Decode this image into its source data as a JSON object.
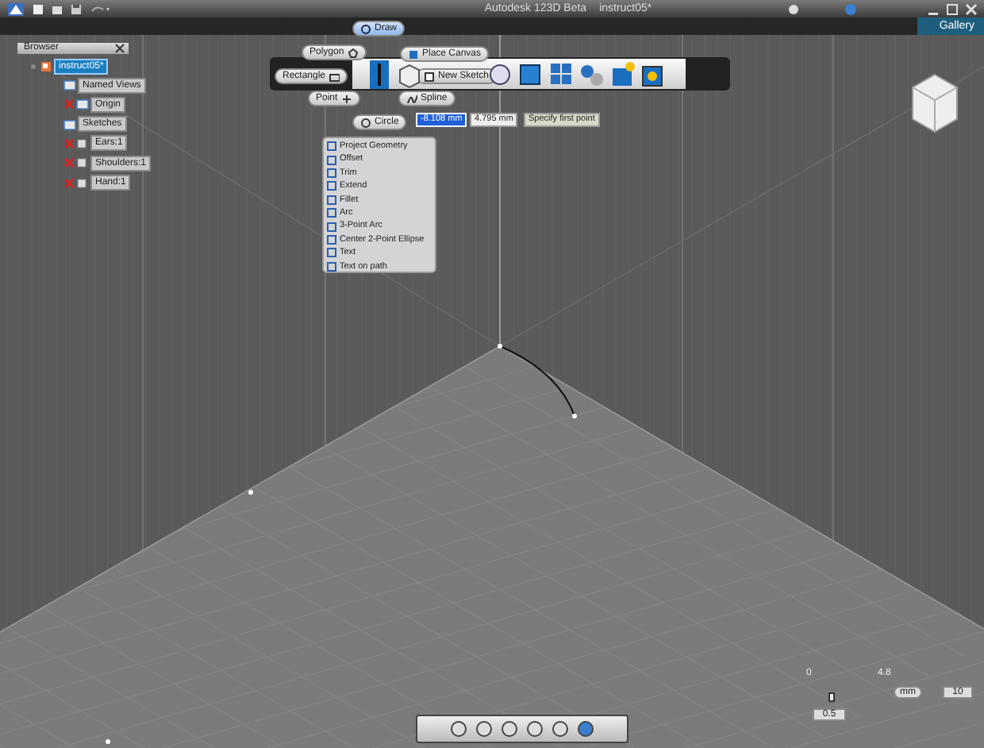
{
  "title_bar": {
    "app_title": "Autodesk 123D Beta",
    "document": "instruct05*"
  },
  "gallery_tab": {
    "label": "Gallery"
  },
  "browser": {
    "title": "Browser",
    "tree": [
      {
        "label": "instruct05*",
        "selected": true,
        "children": [
          {
            "label": "Named Views",
            "kind": "folder",
            "hidden": false
          },
          {
            "label": "Origin",
            "kind": "folder",
            "hidden": true
          },
          {
            "label": "Sketches",
            "kind": "folder",
            "hidden": false
          },
          {
            "label": "Ears:1",
            "kind": "body",
            "hidden": true
          },
          {
            "label": "Shoulders:1",
            "kind": "body",
            "hidden": true
          },
          {
            "label": "Hand:1",
            "kind": "body",
            "hidden": true
          }
        ]
      }
    ]
  },
  "draw_toolbar": {
    "menu_label": "Draw",
    "tools": [
      {
        "label": "Polygon"
      },
      {
        "label": "Rectangle"
      },
      {
        "label": "Point"
      },
      {
        "label": "Place Canvas"
      },
      {
        "label": "New Sketch"
      },
      {
        "label": "Spline"
      },
      {
        "label": "Circle"
      }
    ]
  },
  "input_fields": [
    {
      "value": "-8.108 mm",
      "selected": true
    },
    {
      "value": "4.795 mm",
      "selected": false
    }
  ],
  "prompt": "Specify first point",
  "context_menu": [
    "Project Geometry",
    "Offset",
    "Trim",
    "Extend",
    "Fillet",
    "Arc",
    "3-Point Arc",
    "Center 2-Point Ellipse",
    "Text",
    "Text on path"
  ],
  "units": {
    "scale_labels": [
      "0",
      "4.8"
    ],
    "scale_value": "0.5",
    "unit": "mm",
    "grid_value": "10"
  }
}
